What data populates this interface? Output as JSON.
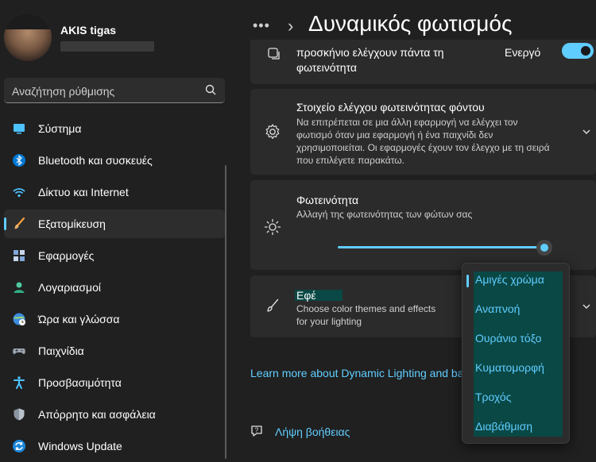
{
  "user": {
    "name": "AKIS tigas"
  },
  "search": {
    "placeholder": "Αναζήτηση ρύθμισης"
  },
  "nav": [
    {
      "label": "Σύστημα",
      "icon": "monitor-icon"
    },
    {
      "label": "Bluetooth και συσκευές",
      "icon": "bluetooth-icon"
    },
    {
      "label": "Δίκτυο και Internet",
      "icon": "wifi-icon"
    },
    {
      "label": "Εξατομίκευση",
      "icon": "brush-icon",
      "active": true
    },
    {
      "label": "Εφαρμογές",
      "icon": "apps-icon"
    },
    {
      "label": "Λογαριασμοί",
      "icon": "person-icon"
    },
    {
      "label": "Ώρα και γλώσσα",
      "icon": "globe-clock-icon"
    },
    {
      "label": "Παιχνίδια",
      "icon": "gamepad-icon"
    },
    {
      "label": "Προσβασιμότητα",
      "icon": "accessibility-icon"
    },
    {
      "label": "Απόρρητο και ασφάλεια",
      "icon": "shield-icon"
    },
    {
      "label": "Windows Update",
      "icon": "update-icon"
    }
  ],
  "header": {
    "dots": "•••",
    "chevron": "›",
    "title": "Δυναμικός φωτισμός"
  },
  "cards": {
    "top": {
      "line1": "προσκήνιο ελέγχουν πάντα τη",
      "line2": "φωτεινότητα",
      "toggle_label": "Ενεργό"
    },
    "background_control": {
      "title": "Στοιχείο ελέγχου φωτεινότητας φόντου",
      "desc": [
        "Να επιτρέπεται σε μια άλλη εφαρμογή να ελέγχει τον",
        "φωτισμό όταν μια εφαρμογή ή ένα παιχνίδι δεν",
        "χρησιμοποιείται. Οι εφαρμογές έχουν τον έλεγχο με τη σειρά",
        "που επιλέγετε παρακάτω."
      ]
    },
    "brightness": {
      "title": "Φωτεινότητα",
      "desc": "Αλλαγή της φωτεινότητας των φώτων σας",
      "value": 1.0
    },
    "effects": {
      "title": "Εφέ",
      "desc": [
        "Choose color themes and effects",
        "for your lighting"
      ]
    }
  },
  "dropdown": {
    "options": [
      "Αμιγές χρώμα",
      "Αναπνοή",
      "Ουράνιο τόξο",
      "Κυματομορφή",
      "Τροχός",
      "Διαβάθμιση"
    ],
    "selected": "Αμιγές χρώμα"
  },
  "learn_more": "Learn more about Dynamic Lighting and ba",
  "help": "Λήψη βοήθειας",
  "colors": {
    "accent": "#60cdff",
    "background": "#202020",
    "card": "#2b2b2b",
    "highlight": "#0a4845"
  }
}
